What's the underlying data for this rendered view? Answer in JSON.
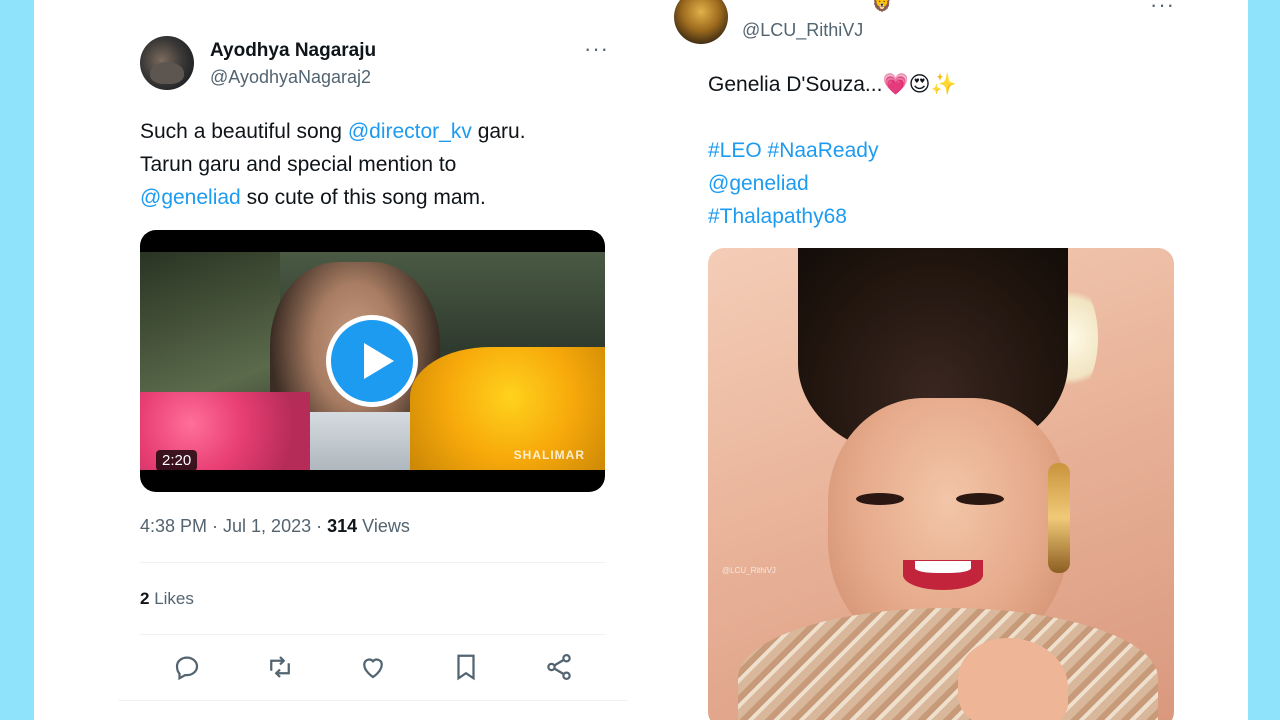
{
  "colors": {
    "background": "#8fe3fb",
    "link": "#1d9bf0",
    "text": "#0f1419",
    "muted": "#536471"
  },
  "left_tweet": {
    "name": "Ayodhya Nagaraju",
    "handle": "@AyodhyaNagaraj2",
    "more_label": "···",
    "text": {
      "part1": "Such a beautiful song ",
      "mention1": "@director_kv",
      "part2": " garu.",
      "line2": "Tarun garu and special mention to",
      "mention2": "@geneliad",
      "part3": " so cute of this song mam."
    },
    "video": {
      "duration": "2:20",
      "watermark": "SHALIMAR"
    },
    "meta": {
      "time": "4:38 PM · Jul 1, 2023 · ",
      "views_count": "314",
      "views_label": " Views"
    },
    "likes": {
      "count": "2",
      "label": " Likes"
    },
    "actions": [
      "reply-icon",
      "retweet-icon",
      "like-icon",
      "bookmark-icon",
      "share-icon"
    ]
  },
  "right_tweet": {
    "handle": "@LCU_RithiVJ",
    "badge_emoji": "🦁",
    "more_label": "···",
    "text": {
      "line1": "Genelia D'Souza...💗😍✨",
      "tags1": "#LEO #NaaReady",
      "mention": "@geneliad",
      "tags2": "#Thalapathy68"
    },
    "image_watermark": "@LCU_RithiVJ"
  }
}
